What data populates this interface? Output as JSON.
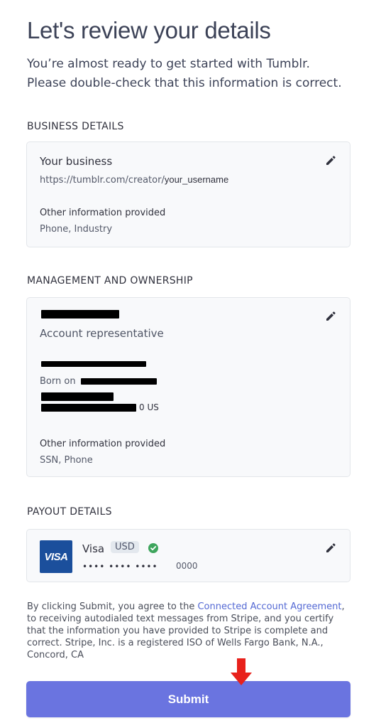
{
  "header": {
    "title": "Let's review your details",
    "subtitle_line1": "You’re almost ready to get started with Tumblr.",
    "subtitle_line2": "Please double-check that this information is correct."
  },
  "business": {
    "section_label": "BUSINESS DETAILS",
    "name": "Your business",
    "url_prefix": "https://tumblr.com/creator/",
    "url_username": "your_username",
    "other_label": "Other information provided",
    "other_value": "Phone, Industry",
    "edit_icon": "pencil-icon"
  },
  "management": {
    "section_label": "MANAGEMENT AND OWNERSHIP",
    "role": "Account representative",
    "born_label": "Born on",
    "address_suffix": "0 US",
    "other_label": "Other information provided",
    "other_value": "SSN, Phone",
    "edit_icon": "pencil-icon"
  },
  "payout": {
    "section_label": "PAYOUT DETAILS",
    "brand_logo": "VISA",
    "card_brand": "Visa",
    "currency": "USD",
    "masked": "•••• •••• ••••",
    "last4": "0000",
    "verified_icon": "check-circle-icon",
    "edit_icon": "pencil-icon"
  },
  "legal": {
    "before_link": "By clicking Submit, you agree to the ",
    "link_text": "Connected Account Agreement",
    "after_link": ", to receiving autodialed text messages from Stripe, and you certify that the information you have provided to Stripe is complete and correct. Stripe, Inc. is a registered ISO of Wells Fargo Bank, N.A., Concord, CA"
  },
  "actions": {
    "submit_label": "Submit"
  },
  "colors": {
    "accent": "#6a74e0",
    "link": "#5469d4",
    "visa_blue": "#1b4f9c",
    "verified_green": "#3ea55d",
    "arrow_red": "#e8211b"
  }
}
